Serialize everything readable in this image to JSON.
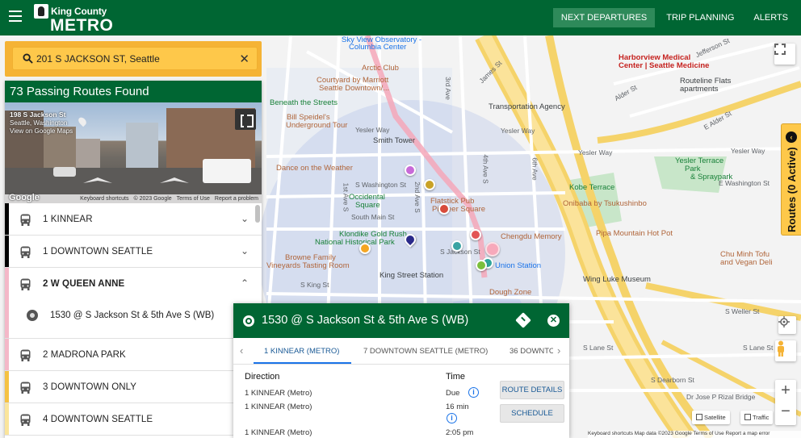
{
  "header": {
    "logo_top": "King County",
    "logo_bottom": "METRO",
    "nav": [
      "NEXT DEPARTURES",
      "TRIP PLANNING",
      "ALERTS"
    ]
  },
  "search": {
    "value": "201 S JACKSON ST, Seattle"
  },
  "panel": {
    "title": "73 Passing Routes Found",
    "streetview": {
      "address": "198 S Jackson St",
      "city": "Seattle, Washington",
      "link": "View on Google Maps",
      "logo": "Google",
      "footer": [
        "Keyboard shortcuts",
        "© 2023 Google",
        "Terms of Use",
        "Report a problem"
      ]
    },
    "routes": [
      {
        "name": "1 KINNEAR",
        "color": "#000000",
        "expanded": false
      },
      {
        "name": "1 DOWNTOWN SEATTLE",
        "color": "#000000",
        "expanded": false
      },
      {
        "name": "2 W QUEEN ANNE",
        "color": "#f4b8c8",
        "expanded": true
      },
      {
        "name": "2 MADRONA PARK",
        "color": "#f4b8c8",
        "expanded": false
      },
      {
        "name": "3 DOWNTOWN ONLY",
        "color": "#f5c242",
        "expanded": false
      },
      {
        "name": "4 DOWNTOWN SEATTLE",
        "color": "#fbe59b",
        "expanded": false
      }
    ],
    "expanded_stop": "1530 @ S Jackson St & 5th Ave S (WB)"
  },
  "popup": {
    "title": "1530 @ S Jackson St & 5th Ave S (WB)",
    "tabs": [
      "1 KINNEAR (METRO)",
      "7 DOWNTOWN SEATTLE (METRO)",
      "36 DOWNTO"
    ],
    "col_direction": "Direction",
    "col_time": "Time",
    "rows": [
      {
        "direction": "1 KINNEAR (Metro)",
        "time": "Due"
      },
      {
        "direction": "1 KINNEAR (Metro)",
        "time": "16  min"
      },
      {
        "direction": "1 KINNEAR (Metro)",
        "time": "2:05 pm"
      }
    ],
    "route_details": "ROUTE DETAILS",
    "schedule": "SCHEDULE"
  },
  "side_tab": "Routes (0 Active)",
  "map": {
    "labels": {
      "sky_view": "Sky View Observatory -",
      "columbia": "Columbia Center",
      "arctic": "Arctic Club",
      "courtyard1": "Courtyard by Marriott",
      "courtyard2": "Seattle Downtown/...",
      "beneath": "Beneath the Streets",
      "bill_speidel1": "Bill Speidel's",
      "bill_speidel2": "Underground Tour",
      "smith": "Smith Tower",
      "transport": "Transportation Agency",
      "james": "James St",
      "harborview1": "Harborview Medical",
      "harborview2": "Center | Seattle Medicine",
      "routeline1": "Routeline Flats",
      "routeline2": "apartments",
      "kobe": "Kobe Terrace",
      "yesler_terrace1": "Yesler Terrace",
      "yesler_terrace2": "Park",
      "yesler_terrace3": "& Spraypark",
      "yesler1": "Yesler Way",
      "yesler2": "Yesler Way",
      "yesler3": "Yesler Way",
      "yesler4": "Yesler Way",
      "dance": "Dance on the Weather",
      "washington": "S Washington St",
      "washington2": "E Washington St",
      "occidental1": "Occidental",
      "occidental2": "Square",
      "main": "South Main St",
      "flatstick1": "Flatstick Pub",
      "flatstick2": "Pioneer Square",
      "klondike1": "Klondike Gold Rush",
      "klondike2": "National Historical Park",
      "browne1": "Browne Family",
      "browne2": "Vineyards Tasting Room",
      "king_station": "King Street Station",
      "chengdu": "Chengdu Memory",
      "union": "Union Station",
      "onibaba": "Onibaba by Tsukushinbo",
      "pipa": "Pipa Mountain Hot Pot",
      "chu1": "Chu Minh Tofu",
      "chu2": "and Vegan Deli",
      "wing": "Wing Luke Museum",
      "dough": "Dough Zone",
      "king_st": "S King St",
      "lane": "S Lane St",
      "lane2": "S Lane St",
      "weller": "S Weller St",
      "dearborn": "S Dearborn St",
      "rizal": "Dr Jose P Rizal Bridge",
      "fourth": "4th Ave S",
      "third": "3rd Ave",
      "second": "2nd Ave S",
      "first": "1st Ave S",
      "sixth": "6th Ave",
      "alder": "Alder St",
      "alder2": "E Alder St",
      "jefferson": "Jefferson St",
      "jackson": "S Jackson St"
    },
    "satellite": "Satellite",
    "traffic": "Traffic",
    "footer": "Keyboard shortcuts   Map data ©2023 Google   Terms of Use   Report a map error"
  }
}
